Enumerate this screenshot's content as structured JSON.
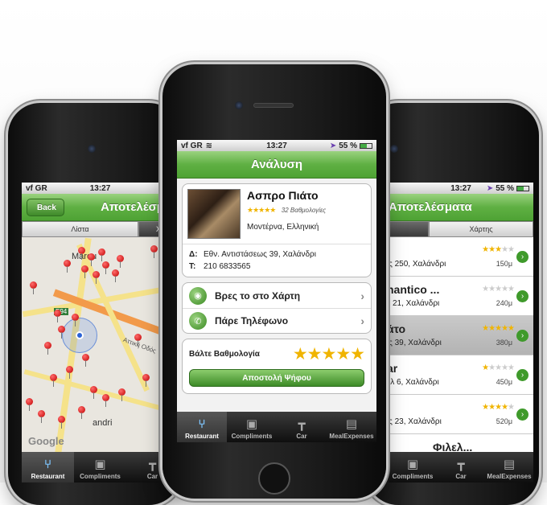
{
  "accent_color": "#5fb043",
  "left_phone": {
    "status": {
      "carrier": "vf GR",
      "time": "13:27"
    },
    "nav": {
      "back_label": "Back",
      "title": "Αποτελέσματ"
    },
    "segments": [
      "Λίστα",
      "Χ"
    ],
    "map": {
      "road_label_1": "E94",
      "road_label_2": "Αττική Οδός",
      "district": "Marou",
      "district_2": "andri",
      "attribution": "Google"
    },
    "tabs": [
      {
        "label": "Restaurant",
        "icon": "fork-knife-icon"
      },
      {
        "label": "Compliments",
        "icon": "gift-icon"
      },
      {
        "label": "Car",
        "icon": "signpost-icon"
      }
    ]
  },
  "center_phone": {
    "status": {
      "carrier": "vf GR",
      "time": "13:27",
      "battery": "55 %"
    },
    "nav": {
      "title": "Ανάλυση"
    },
    "restaurant": {
      "name": "Ασπρο Πιάτο",
      "stars": "★★★★★",
      "ratings": "32 Βαθμολογίες",
      "cuisine": "Μοντέρνα, Ελληνική",
      "address_label": "Δ:",
      "address": "Εθν. Αντιστάσεως 39, Χαλάνδρι",
      "phone_label": "Τ:",
      "phone": "210 6833565"
    },
    "actions": [
      {
        "label": "Βρες το στο Χάρτη",
        "icon": "globe-icon"
      },
      {
        "label": "Πάρε Τηλέφωνο",
        "icon": "phone-icon"
      }
    ],
    "rating": {
      "label": "Βάλτε Βαθμολογία",
      "stars": "★★★★★",
      "submit": "Αποστολή Ψήφου"
    },
    "tabs": [
      {
        "label": "Restaurant",
        "icon": "fork-knife-icon"
      },
      {
        "label": "Compliments",
        "icon": "gift-icon"
      },
      {
        "label": "Car",
        "icon": "signpost-icon"
      },
      {
        "label": "MealExpenses",
        "icon": "briefcase-icon"
      }
    ]
  },
  "right_phone": {
    "status": {
      "time": "13:27",
      "battery": "55 %"
    },
    "nav": {
      "title": "Αποτελέσματα"
    },
    "segments": [
      "",
      "Χάρτης"
    ],
    "rows": [
      {
        "name": "",
        "address": "ς 250, Χαλάνδρι",
        "gold_stars": "★★★",
        "grey_stars": "★★",
        "distance": "150μ"
      },
      {
        "name": "nantico ...",
        "address": "ι 21, Χαλάνδρι",
        "gold_stars": "",
        "grey_stars": "★★★★★",
        "distance": "240μ"
      },
      {
        "name": "άτο",
        "address": "ς 39, Χαλάνδρι",
        "gold_stars": "★★★★★",
        "grey_stars": "",
        "distance": "380μ"
      },
      {
        "name": "ar",
        "address": "ιλ 6, Χαλάνδρι",
        "gold_stars": "★",
        "grey_stars": "★★★★",
        "distance": "450μ"
      },
      {
        "name": "",
        "address": "ς 23, Χαλάνδρι",
        "gold_stars": "★★★★",
        "grey_stars": "★",
        "distance": "520μ"
      },
      {
        "name": "Φιλελ...",
        "address": "",
        "gold_stars": "",
        "grey_stars": "",
        "distance": ""
      }
    ],
    "tabs": [
      {
        "label": "Compliments",
        "icon": "gift-icon"
      },
      {
        "label": "Car",
        "icon": "signpost-icon"
      },
      {
        "label": "MealExpenses",
        "icon": "briefcase-icon"
      }
    ]
  }
}
